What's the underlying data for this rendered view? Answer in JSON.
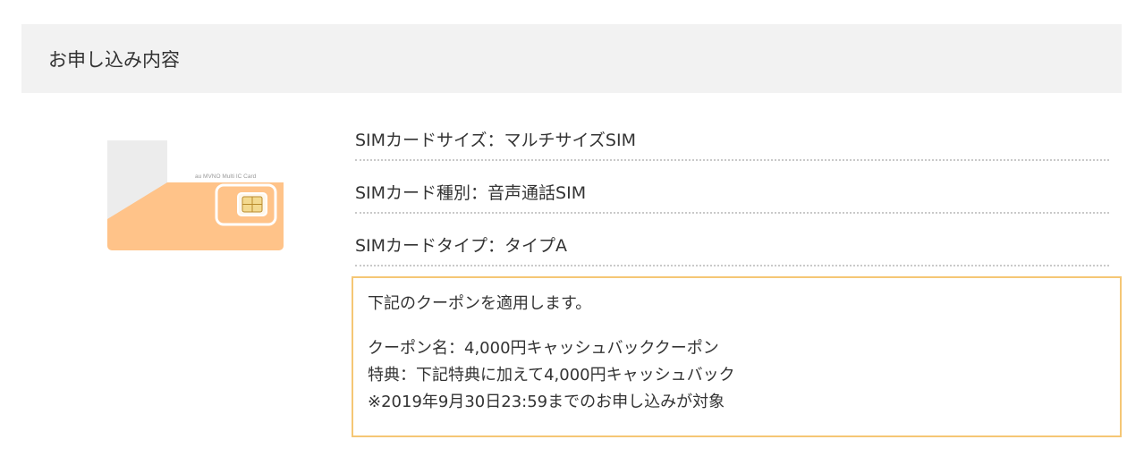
{
  "header": {
    "title": "お申し込み内容"
  },
  "sim_card": {
    "caption": "au MVNO Multi IC Card",
    "colors": {
      "card": "#ffc389",
      "corner": "#ececec"
    }
  },
  "specs": [
    {
      "text": "SIMカードサイズ：マルチサイズSIM"
    },
    {
      "text": "SIMカード種別：音声通話SIM"
    },
    {
      "text": "SIMカードタイプ：タイプA"
    }
  ],
  "coupon": {
    "intro": "下記のクーポンを適用します。",
    "name_line": "クーポン名：4,000円キャッシュバッククーポン",
    "benefit_line": "特典：下記特典に加えて4,000円キャッシュバック",
    "deadline_line": "※2019年9月30日23:59までのお申し込みが対象",
    "border_color": "#f5c775"
  }
}
